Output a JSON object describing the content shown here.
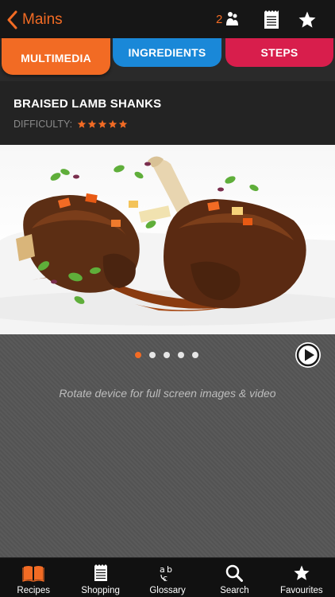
{
  "nav": {
    "back_label": "Mains",
    "servings_count": "2"
  },
  "tabs": [
    {
      "label": "MULTIMEDIA",
      "color": "#f26b24",
      "active": true
    },
    {
      "label": "INGREDIENTS",
      "color": "#1a88d8",
      "active": false
    },
    {
      "label": "STEPS",
      "color": "#d81e4c",
      "active": false
    }
  ],
  "recipe": {
    "title": "BRAISED LAMB SHANKS",
    "difficulty_label": "DIFFICULTY:",
    "difficulty_rating": 5,
    "difficulty_max": 5
  },
  "media": {
    "image_count": 5,
    "active_index": 0,
    "hint": "Rotate device for full screen images & video"
  },
  "tabbar": [
    {
      "label": "Recipes",
      "icon": "book-icon",
      "active": true
    },
    {
      "label": "Shopping",
      "icon": "notepad-icon",
      "active": false
    },
    {
      "label": "Glossary",
      "icon": "abc-icon",
      "active": false
    },
    {
      "label": "Search",
      "icon": "search-icon",
      "active": false
    },
    {
      "label": "Favourites",
      "icon": "star-icon",
      "active": false
    }
  ],
  "colors": {
    "accent": "#f26b24",
    "ingredients": "#1a88d8",
    "steps": "#d81e4c"
  }
}
